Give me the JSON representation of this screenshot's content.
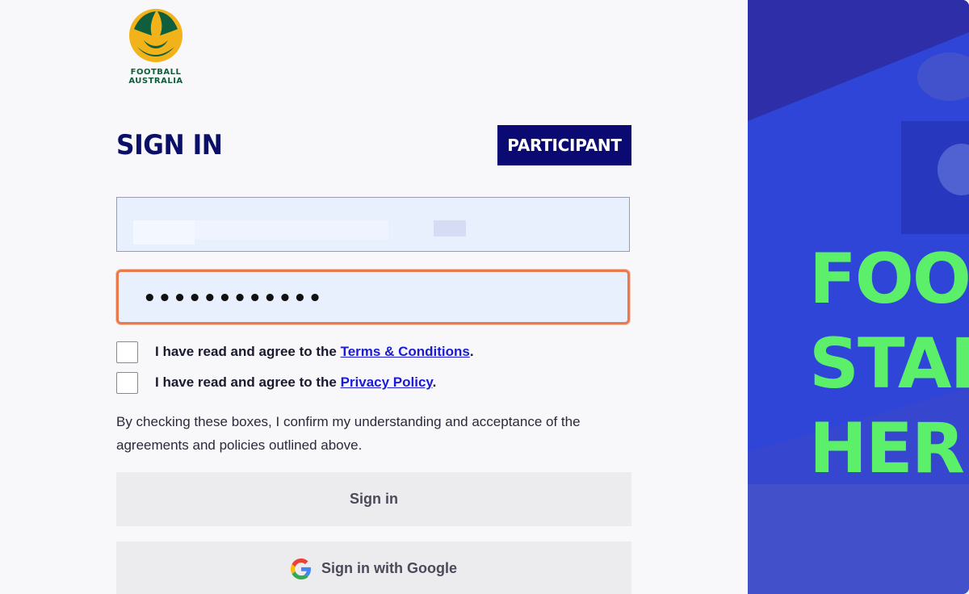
{
  "brand": {
    "logo_line1": "FOOTBALL",
    "logo_line2": "AUSTRALIA",
    "logo_icon": "football-australia-ball-icon"
  },
  "header": {
    "title": "SIGN IN",
    "role_badge": "PARTICIPANT"
  },
  "form": {
    "email_value": "",
    "password_value": "••••••••••••",
    "terms": {
      "prefix": "I have read and agree to the ",
      "link": "Terms & Conditions",
      "suffix": ".",
      "checked": false
    },
    "privacy": {
      "prefix": "I have read and agree to the ",
      "link": "Privacy Policy",
      "suffix": ".",
      "checked": false
    },
    "note": "By checking these boxes, I confirm my understanding and acceptance of the agreements and policies outlined above.",
    "signin_label": "Sign in",
    "google_label": "Sign in with Google",
    "google_icon": "google-g-icon"
  },
  "hero": {
    "line1": "FOO",
    "line2": "STAR",
    "line3": "HERE"
  },
  "colors": {
    "navy": "#0a1068",
    "badge_bg": "#0a0a72",
    "focus_border": "#ea7a4c",
    "input_bg": "#e8f0fe",
    "hero_bg": "#2b37c9",
    "hero_text": "#5cf06a",
    "link": "#1a1ad8"
  }
}
